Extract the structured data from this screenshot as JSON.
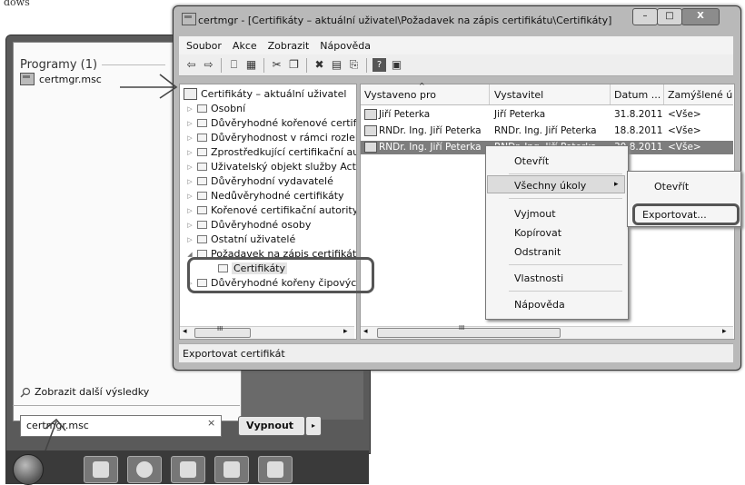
{
  "page_caption": "dows",
  "start_menu": {
    "programs_heading": "Programy (1)",
    "program_item": "certmgr.msc",
    "more_results": "Zobrazit další výsledky",
    "search_value": "certmgr.msc",
    "search_clear": "×",
    "shutdown_label": "Vypnout",
    "shutdown_arrow": "▸"
  },
  "window": {
    "title": "certmgr - [Certifikáty – aktuální uživatel\\Požadavek na zápis certifikátu\\Certifikáty]",
    "btn_min": "–",
    "btn_max": "□",
    "btn_close": "X",
    "menu": [
      "Soubor",
      "Akce",
      "Zobrazit",
      "Nápověda"
    ],
    "tree": [
      {
        "label": "Certifikáty – aktuální uživatel",
        "level": "root"
      },
      {
        "label": "Osobní",
        "level": "1"
      },
      {
        "label": "Důvěryhodné kořenové certif",
        "level": "1"
      },
      {
        "label": "Důvěryhodnost v rámci rozlel",
        "level": "1"
      },
      {
        "label": "Zprostředkující certifikační au",
        "level": "1"
      },
      {
        "label": "Uživatelský objekt služby Acti",
        "level": "1"
      },
      {
        "label": "Důvěryhodní vydavatelé",
        "level": "1"
      },
      {
        "label": "Nedůvěryhodné certifikáty",
        "level": "1"
      },
      {
        "label": "Kořenové certifikační autority",
        "level": "1"
      },
      {
        "label": "Důvěryhodné osoby",
        "level": "1"
      },
      {
        "label": "Ostatní uživatelé",
        "level": "1"
      },
      {
        "label": "Požadavek na zápis certifikátu",
        "level": "1"
      },
      {
        "label": "Certifikáty",
        "level": "2"
      },
      {
        "label": "Důvěryhodné kořeny čipových",
        "level": "1"
      }
    ],
    "columns": [
      "Vystaveno pro",
      "Vystavitel",
      "Datum ...",
      "Zamýšlené ú"
    ],
    "rows": [
      [
        "Jiří Peterka",
        "Jiří Peterka",
        "31.8.2011",
        "<Vše>"
      ],
      [
        "RNDr. Ing. Jiří Peterka",
        "RNDr. Ing. Jiří Peterka",
        "18.8.2011",
        "<Vše>"
      ],
      [
        "RNDr. Ing. Jiří Peterka",
        "RNDr. Ing. Jiří Peterka",
        "30.8.2011",
        "<Vše>"
      ]
    ],
    "status": "Exportovat certifikát",
    "scroll_left": "◂",
    "scroll_right": "▸",
    "scroll_grip": "III"
  },
  "context_menu": {
    "items": [
      "Otevřít",
      "Všechny úkoly",
      "Vyjmout",
      "Kopírovat",
      "Odstranit",
      "Vlastnosti",
      "Nápověda"
    ],
    "submenu_arrow": "▸",
    "submenu": [
      "Otevřít",
      "Exportovat..."
    ]
  }
}
